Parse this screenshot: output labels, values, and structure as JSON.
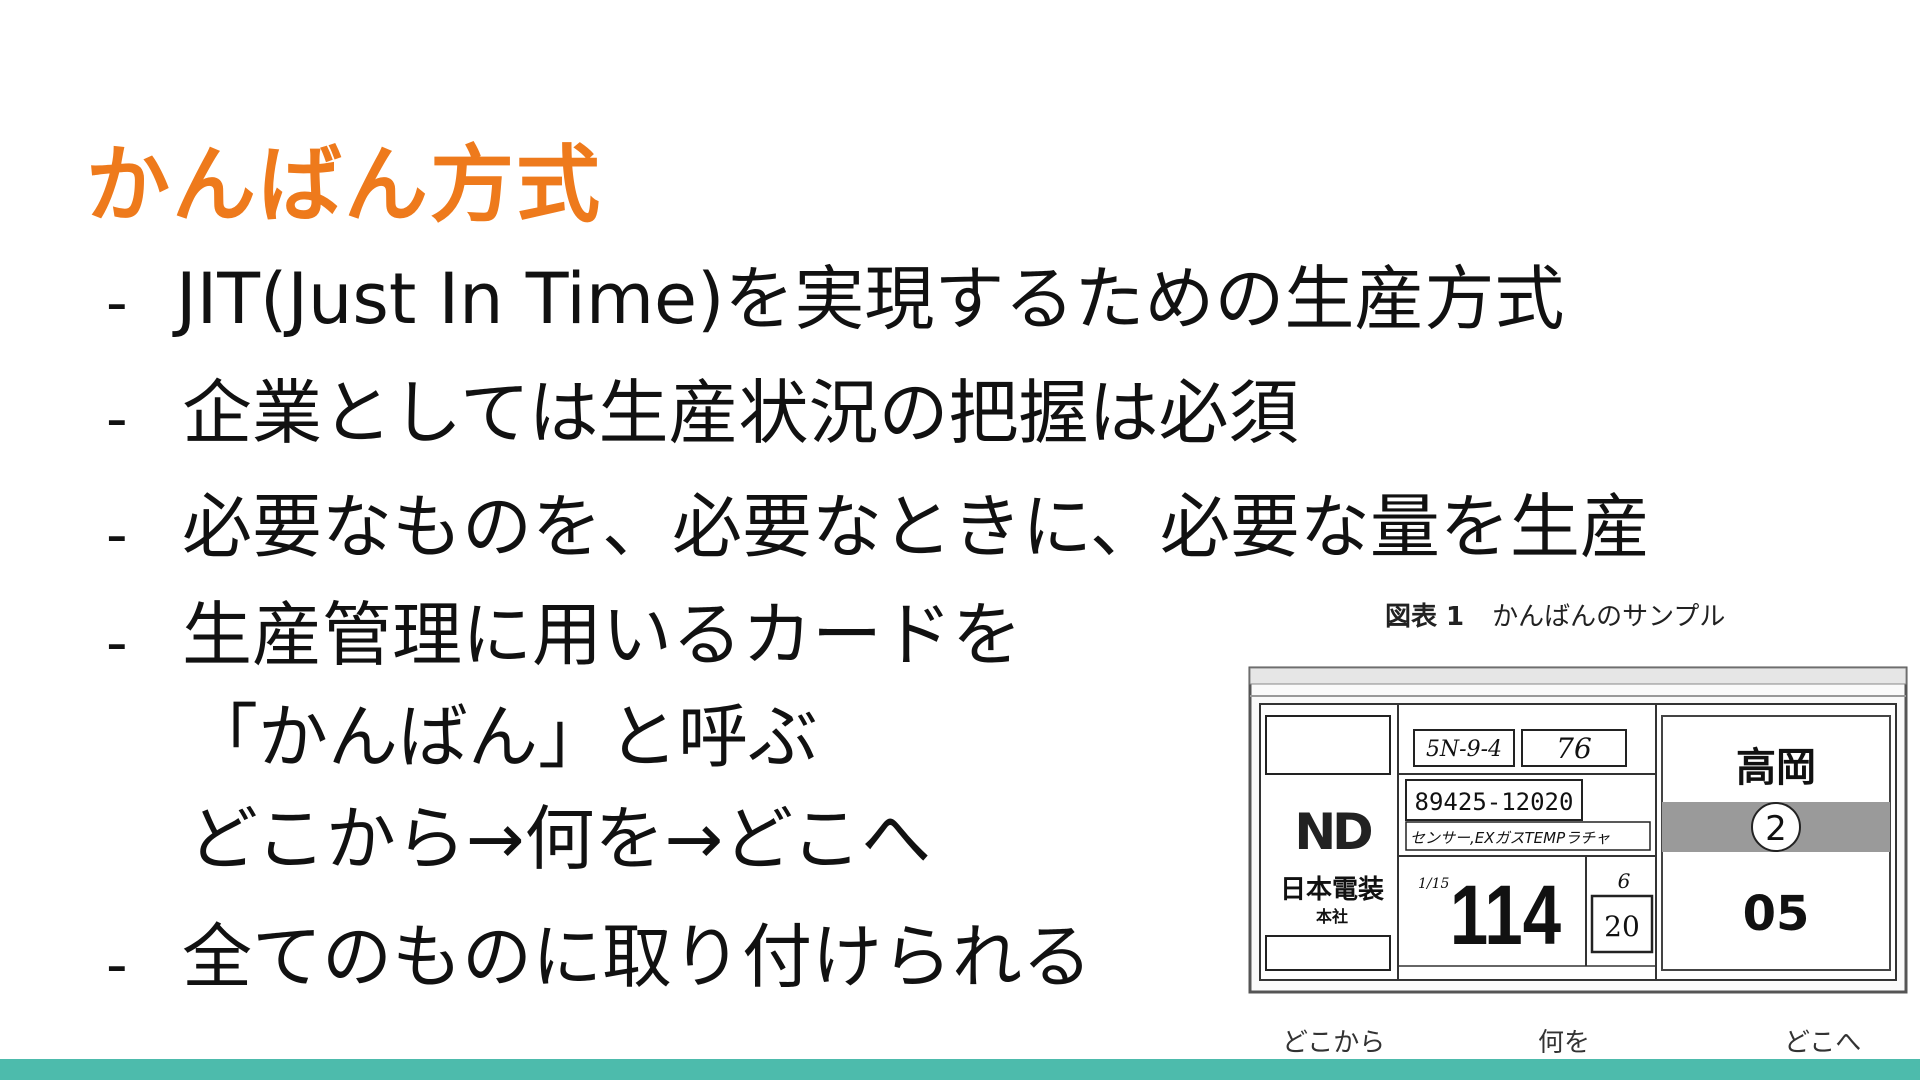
{
  "slide": {
    "title": "かんばん方式",
    "bullets": [
      {
        "dash": "-",
        "text": "JIT(Just In Time)を実現するための生産方式"
      },
      {
        "dash": "-",
        "text": "企業としては生産状況の把握は必須"
      },
      {
        "dash": "-",
        "text": "必要なものを、必要なときに、必要な量を生産"
      },
      {
        "dash": "-",
        "text": "生産管理に用いるカードを",
        "continuation": [
          "「かんばん」と呼ぶ",
          "どこから→何を→どこへ"
        ]
      },
      {
        "dash": "-",
        "text": "全てのものに取り付けられる"
      }
    ]
  },
  "figure": {
    "caption_label": "図表 1",
    "caption_text": "かんばんのサンプル",
    "kanban": {
      "box1": "5N-9-4",
      "box2": "76",
      "part_number": "89425-12020",
      "part_name": "センサー,EXガスTEMPラチャ",
      "small_label": "1/15",
      "quantity": "114",
      "small_value_top": "6",
      "small_value_bottom": "20",
      "company_logo": "ND",
      "company_name": "日本電装",
      "company_branch": "本社",
      "destination": "高岡",
      "dest_number": "2",
      "dest_code": "05"
    },
    "bottom_labels": [
      "どこから",
      "何を",
      "どこへ"
    ]
  },
  "colors": {
    "title": "#ee7a1c",
    "bottom_bar": "#4dbbac"
  }
}
